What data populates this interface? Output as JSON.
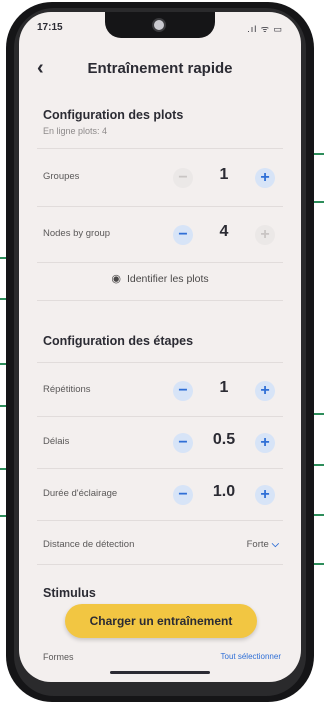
{
  "status": {
    "time": "17:15",
    "icons": ".ıl ᯤ ▭"
  },
  "header": {
    "back_icon": "chevron-left-icon",
    "title": "Entraînement rapide"
  },
  "plots_section": {
    "title": "Configuration des plots",
    "subtitle": "En ligne plots: 4"
  },
  "rows": {
    "groupes": {
      "label": "Groupes",
      "value": "1",
      "minus": "−",
      "plus": "+"
    },
    "nodes": {
      "label": "Nodes by group",
      "value": "4",
      "minus": "−",
      "plus": "+"
    }
  },
  "identify": {
    "icon": "eye-icon",
    "label": "Identifier les plots"
  },
  "steps_section": {
    "title": "Configuration des étapes"
  },
  "step_rows": {
    "repetitions": {
      "label": "Répétitions",
      "value": "1",
      "minus": "−",
      "plus": "+"
    },
    "delais": {
      "label": "Délais",
      "value": "0.5",
      "minus": "−",
      "plus": "+"
    },
    "duree": {
      "label": "Durée d'éclairage",
      "value": "1.0",
      "minus": "−",
      "plus": "+"
    }
  },
  "detection": {
    "label": "Distance de détection",
    "value": "Forte",
    "chevron": "⌵"
  },
  "stimulus": {
    "title": "Stimulus"
  },
  "cta": {
    "label": "Charger un entraînement"
  },
  "formes": {
    "label": "Formes",
    "action": "Tout sélectionner"
  },
  "colors": {
    "accent": "#2f6fd6",
    "cta": "#f2c642",
    "background": "#f3efee",
    "marker": "#2e8e5b"
  }
}
